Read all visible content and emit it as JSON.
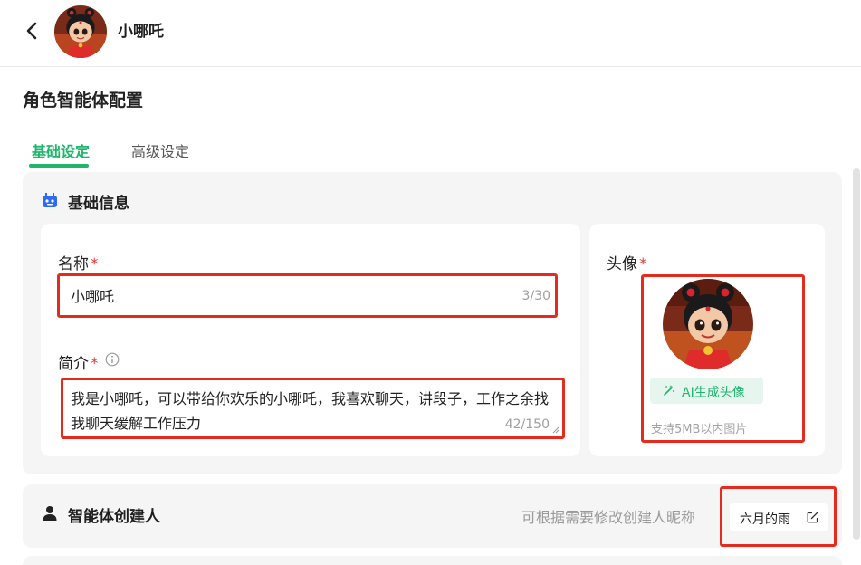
{
  "header": {
    "name": "小哪吒",
    "back_icon": "chevron-left-icon"
  },
  "page": {
    "title": "角色智能体配置",
    "tabs": [
      {
        "label": "基础设定",
        "active": true
      },
      {
        "label": "高级设定",
        "active": false
      }
    ]
  },
  "basic_info": {
    "section_title": "基础信息",
    "name_label": "名称",
    "required_mark": "*",
    "name_value": "小哪吒",
    "name_count": "3/30",
    "desc_label": "简介",
    "desc_value": "我是小哪吒，可以带给你欢乐的小哪吒，我喜欢聊天，讲段子，工作之余找我聊天缓解工作压力",
    "desc_count": "42/150",
    "avatar_label": "头像",
    "ai_button": "AI生成头像",
    "support_text": "支持5MB以内图片"
  },
  "creator": {
    "section_title": "智能体创建人",
    "hint": "可根据需要修改创建人昵称",
    "name": "六月的雨"
  },
  "colors": {
    "accent": "#1fb56b",
    "highlight_box": "#e52a1e",
    "required": "#e53935",
    "section_bg": "#f5f5f5"
  }
}
